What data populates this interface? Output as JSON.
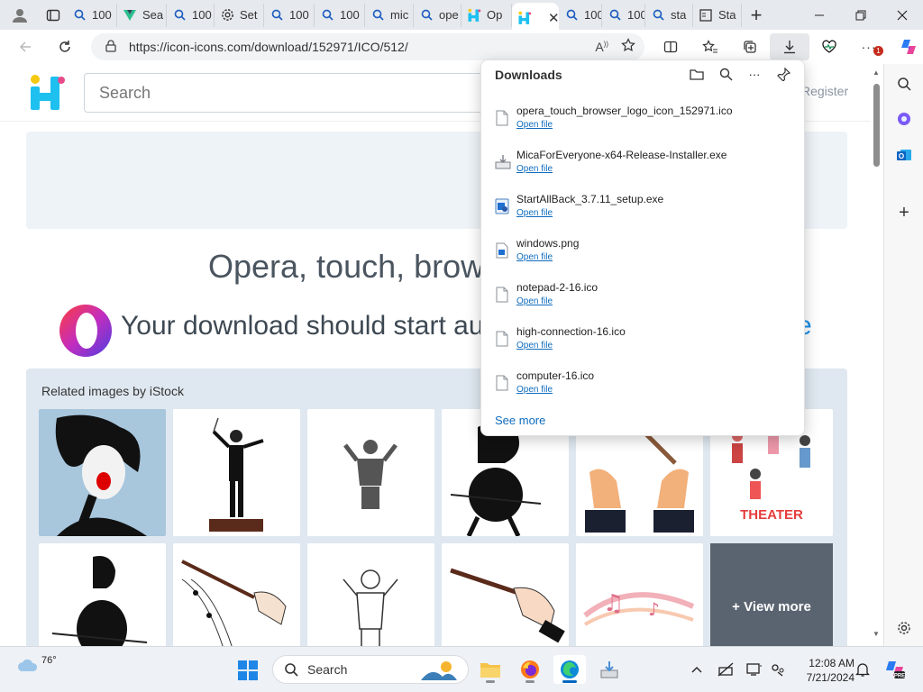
{
  "browser": {
    "tabs": [
      {
        "label": "100",
        "icon": "search-icon"
      },
      {
        "label": "Sea",
        "icon": "vue-logo-icon"
      },
      {
        "label": "100",
        "icon": "search-icon"
      },
      {
        "label": "Set",
        "icon": "gear-icon"
      },
      {
        "label": "100",
        "icon": "search-icon"
      },
      {
        "label": "100",
        "icon": "search-icon"
      },
      {
        "label": "mic",
        "icon": "search-icon"
      },
      {
        "label": "ope",
        "icon": "search-icon"
      },
      {
        "label": "Op",
        "icon": "iconicons-logo-icon"
      },
      {
        "label": "",
        "icon": "iconicons-logo-icon",
        "active": true
      },
      {
        "label": "100",
        "icon": "search-icon"
      },
      {
        "label": "100",
        "icon": "search-icon"
      },
      {
        "label": "sta",
        "icon": "search-icon"
      },
      {
        "label": "Sta",
        "icon": "document-icon"
      }
    ],
    "url": "https://icon-icons.com/download/152971/ICO/512/",
    "notification_count": "1"
  },
  "site": {
    "search_placeholder": "Search",
    "register_label": "Register",
    "title": "Opera, touch, brows",
    "download_message": "Your download should start au",
    "download_message_tail": "e",
    "related_title": "Related images by iStock",
    "view_more": "+ View more"
  },
  "downloads": {
    "title": "Downloads",
    "open_label": "Open file",
    "see_more": "See more",
    "items": [
      {
        "name": "opera_touch_browser_logo_icon_152971.ico",
        "icon": "file-icon"
      },
      {
        "name": "MicaForEveryone-x64-Release-Installer.exe",
        "icon": "installer-icon"
      },
      {
        "name": "StartAllBack_3.7.11_setup.exe",
        "icon": "exe-app-icon"
      },
      {
        "name": "windows.png",
        "icon": "image-file-icon"
      },
      {
        "name": "notepad-2-16.ico",
        "icon": "file-icon"
      },
      {
        "name": "high-connection-16.ico",
        "icon": "file-icon"
      },
      {
        "name": "computer-16.ico",
        "icon": "file-icon"
      }
    ]
  },
  "taskbar": {
    "temperature": "76°",
    "search_label": "Search",
    "time": "12:08 AM",
    "date": "7/21/2024"
  },
  "colors": {
    "accent": "#0f6cbd",
    "link_blue": "#1e90e6",
    "opera_red": "#e2263d",
    "opera_purple": "#6b3fd6"
  }
}
